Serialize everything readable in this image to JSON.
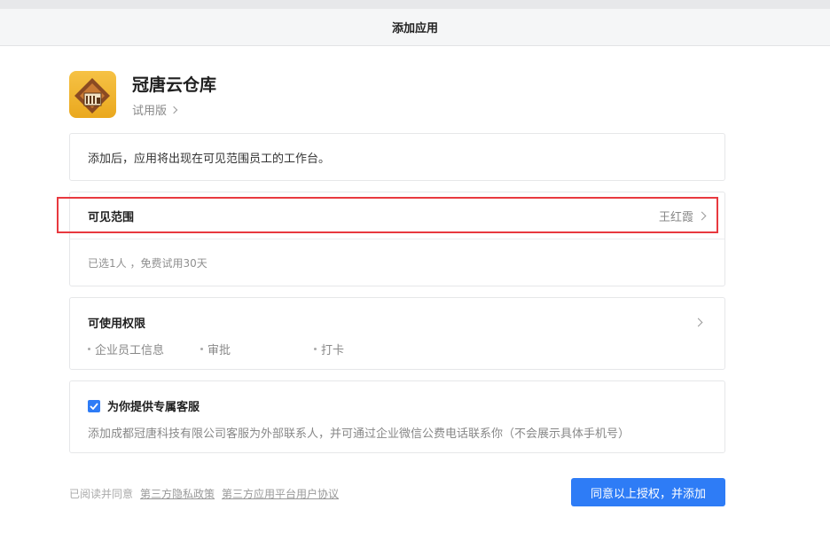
{
  "header": {
    "title": "添加应用"
  },
  "app": {
    "name": "冠唐云仓库",
    "edition": "试用版"
  },
  "intro": {
    "text": "添加后，应用将出现在可见范围员工的工作台。"
  },
  "scope": {
    "title": "可见范围",
    "value": "王红霞",
    "note": "已选1人 ，免费试用30天"
  },
  "permissions": {
    "title": "可使用权限",
    "items": [
      {
        "label": "企业员工信息"
      },
      {
        "label": "审批"
      },
      {
        "label": "打卡"
      }
    ]
  },
  "service": {
    "checked": true,
    "title": "为你提供专属客服",
    "description": "添加成都冠唐科技有限公司客服为外部联系人，并可通过企业微信公费电话联系你（不会展示具体手机号）"
  },
  "footer": {
    "prefix": "已阅读并同意",
    "privacy_link": "第三方隐私政策",
    "agreement_link": "第三方应用平台用户协议",
    "agree_button": "同意以上授权，并添加"
  },
  "colors": {
    "accent": "#2e7cf6",
    "highlight": "#e8393f",
    "logo": "#f0b030"
  }
}
